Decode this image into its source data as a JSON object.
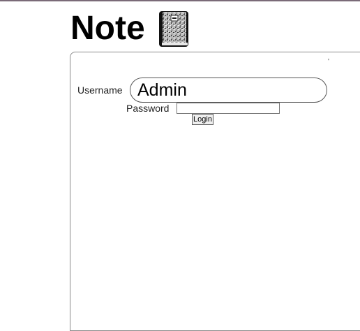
{
  "app": {
    "title": "Note",
    "icon": "notebook-icon"
  },
  "panel": {
    "corner_mark": "'"
  },
  "login_form": {
    "username_label": "Username",
    "username_value": "Admin",
    "password_label": "Password",
    "password_value": "",
    "login_label": "Login"
  },
  "colors": {
    "top_border": "#7a6a78",
    "panel_border": "#8a8a8a"
  }
}
